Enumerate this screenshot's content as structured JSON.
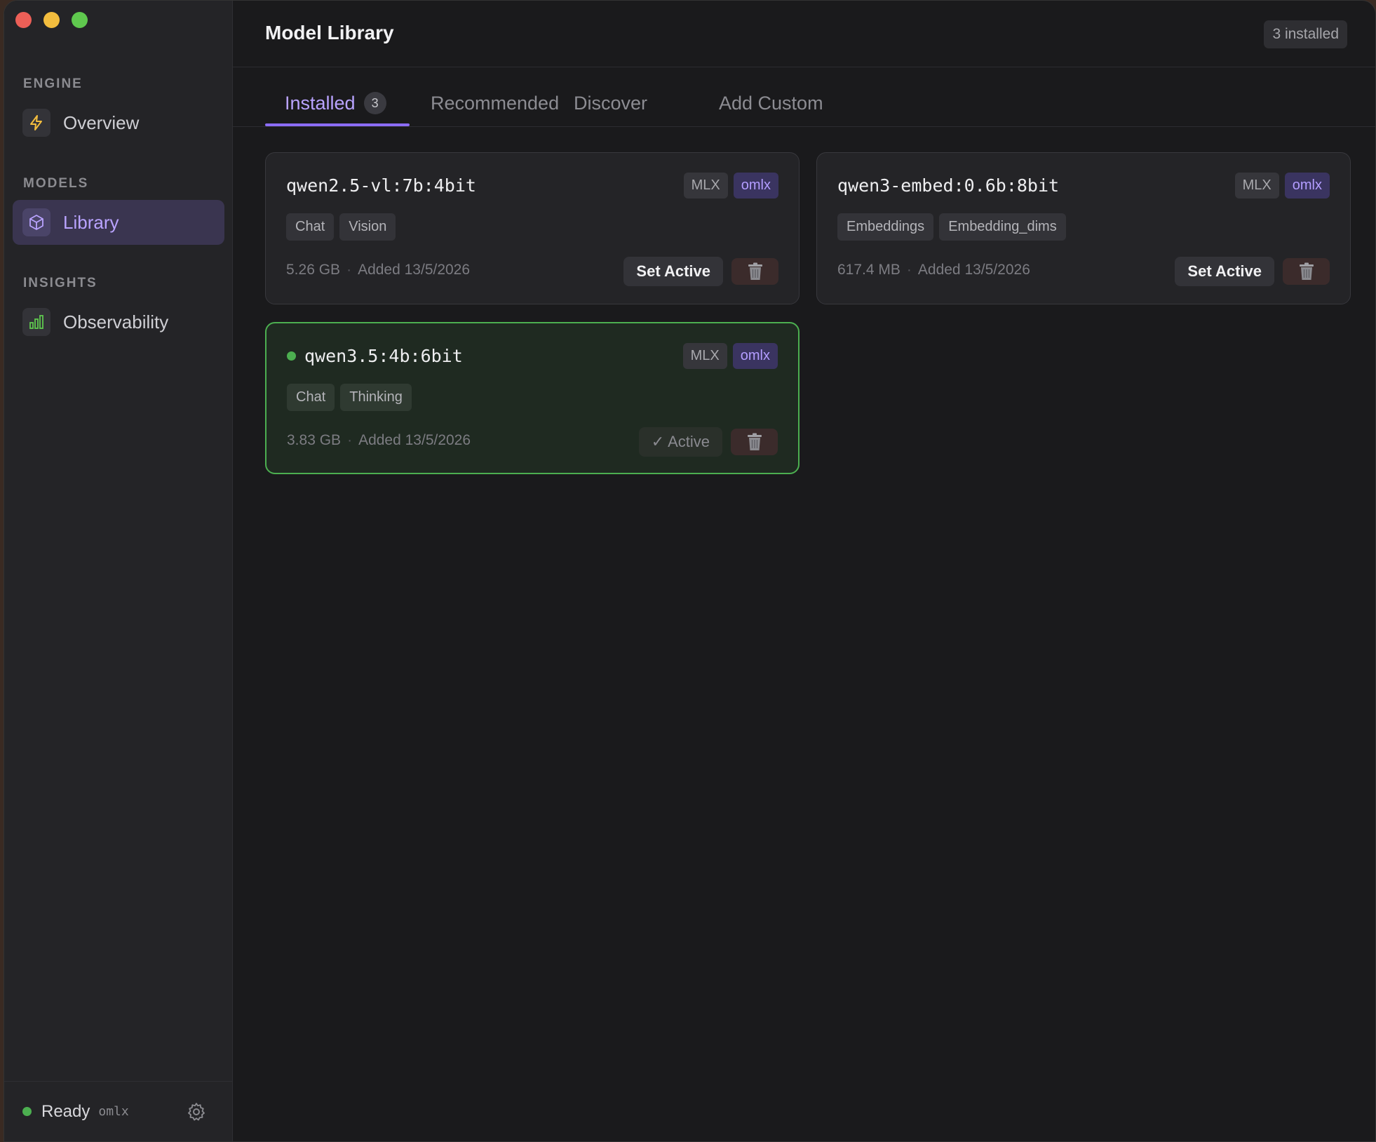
{
  "sidebar": {
    "sections": [
      {
        "label": "ENGINE",
        "items": [
          {
            "label": "Overview",
            "icon": "lightning-icon"
          }
        ]
      },
      {
        "label": "MODELS",
        "items": [
          {
            "label": "Library",
            "icon": "cube-icon",
            "active": true
          }
        ]
      },
      {
        "label": "INSIGHTS",
        "items": [
          {
            "label": "Observability",
            "icon": "bar-chart-icon"
          }
        ]
      }
    ],
    "status": {
      "text": "Ready",
      "engine": "omlx"
    }
  },
  "header": {
    "title": "Model Library",
    "count_label": "3 installed"
  },
  "tabs": [
    {
      "label": "Installed",
      "badge": "3",
      "active": true
    },
    {
      "label": "Recommended"
    },
    {
      "label": "Discover"
    },
    {
      "label": "Add Custom"
    }
  ],
  "models": [
    {
      "name": "qwen2.5-vl:7b:4bit",
      "format": "MLX",
      "engine": "omlx",
      "tags": [
        "Chat",
        "Vision"
      ],
      "size": "5.26 GB",
      "added": "Added 13/5/2026",
      "action": "Set Active",
      "active": false
    },
    {
      "name": "qwen3-embed:0.6b:8bit",
      "format": "MLX",
      "engine": "omlx",
      "tags": [
        "Embeddings",
        "Embedding_dims"
      ],
      "size": "617.4 MB",
      "added": "Added 13/5/2026",
      "action": "Set Active",
      "active": false
    },
    {
      "name": "qwen3.5:4b:6bit",
      "format": "MLX",
      "engine": "omlx",
      "tags": [
        "Chat",
        "Thinking"
      ],
      "size": "3.83 GB",
      "added": "Added 13/5/2026",
      "action": "✓ Active",
      "active": true
    }
  ],
  "colors": {
    "accent": "#8b6cf6",
    "active_green": "#4caf50"
  }
}
